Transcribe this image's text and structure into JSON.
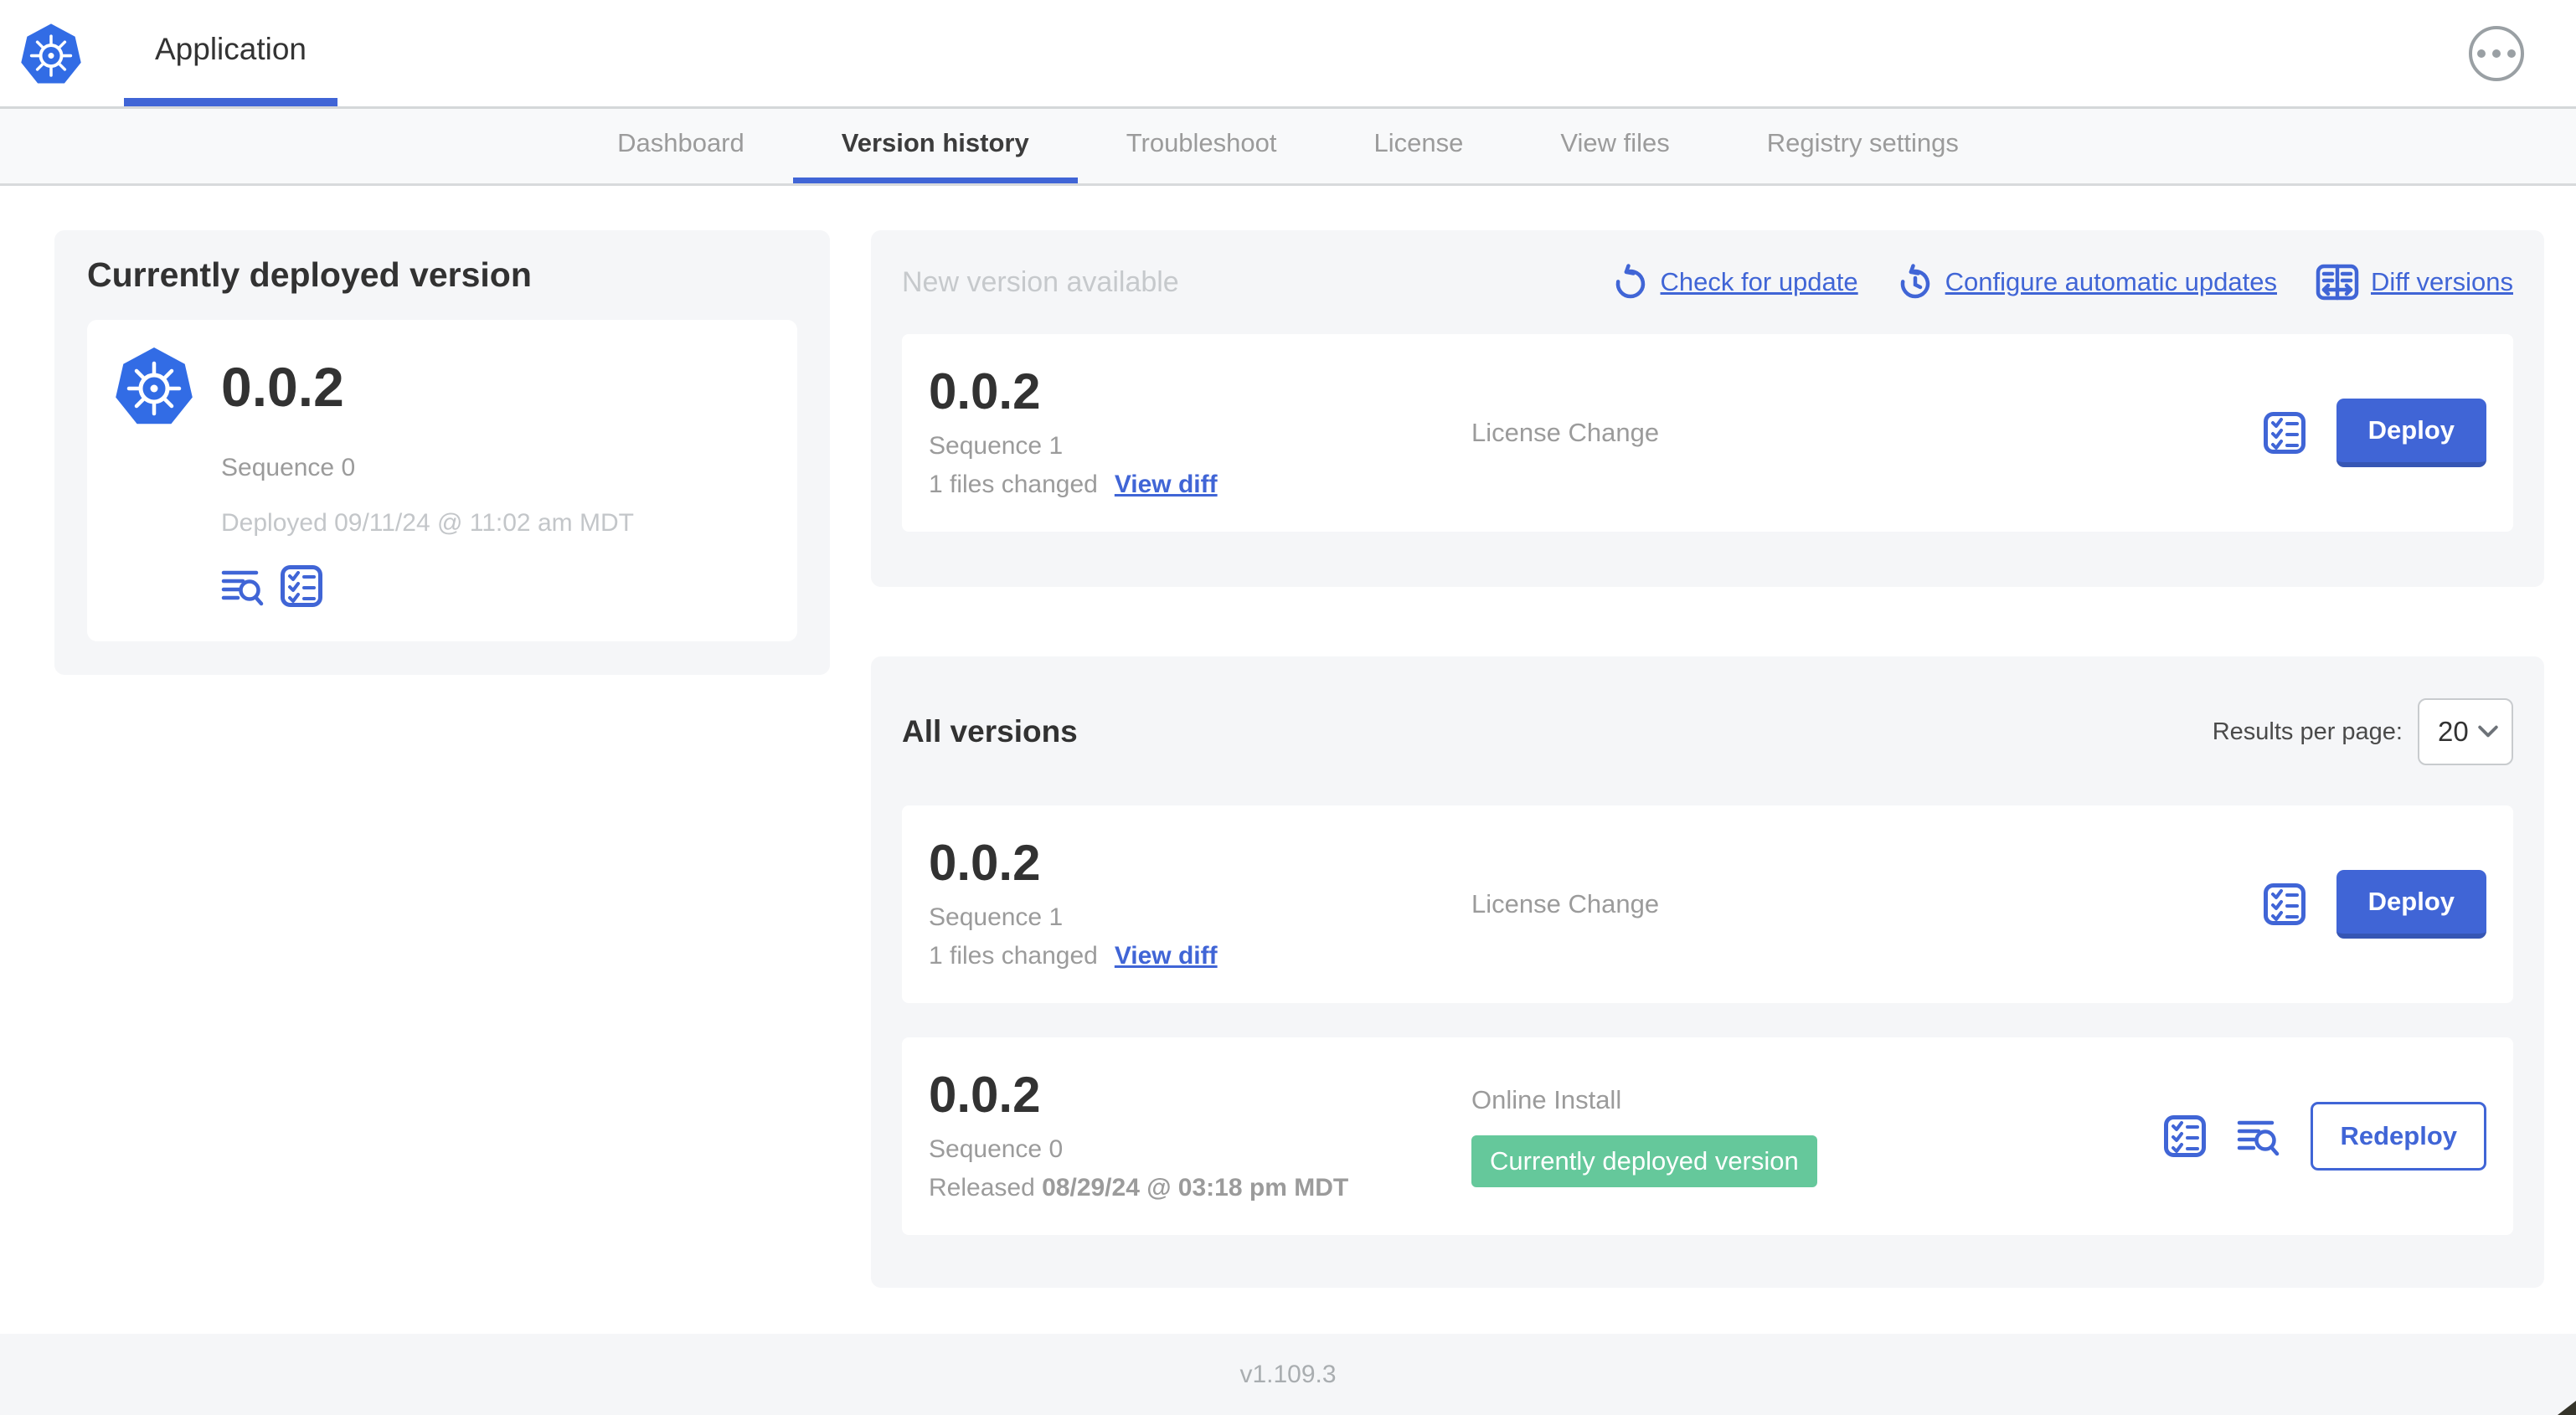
{
  "header": {
    "app_label": "Application"
  },
  "nav": {
    "tabs": [
      "Dashboard",
      "Version history",
      "Troubleshoot",
      "License",
      "View files",
      "Registry settings"
    ],
    "active_tab": "Version history"
  },
  "current_version": {
    "heading": "Currently deployed version",
    "version": "0.0.2",
    "sequence": "Sequence 0",
    "deployed": "Deployed 09/11/24 @ 11:02 am MDT"
  },
  "new_version": {
    "heading": "New version available",
    "check_for_update": "Check for update",
    "configure_updates": "Configure automatic updates",
    "diff_versions": "Diff versions",
    "card": {
      "version": "0.0.2",
      "sequence": "Sequence 1",
      "files_changed": "1 files changed",
      "view_diff": "View diff",
      "source": "License Change",
      "deploy": "Deploy"
    }
  },
  "all_versions": {
    "heading": "All versions",
    "results_per_page_label": "Results per page:",
    "results_per_page": "20",
    "rows": [
      {
        "version": "0.0.2",
        "sequence": "Sequence 1",
        "files_changed": "1 files changed",
        "view_diff": "View diff",
        "source": "License Change",
        "action": "Deploy"
      },
      {
        "version": "0.0.2",
        "sequence": "Sequence 0",
        "released_label": "Released",
        "released_date": "08/29/24 @ 03:18 pm MDT",
        "source": "Online Install",
        "badge": "Currently deployed version",
        "action": "Redeploy"
      }
    ]
  },
  "footer": {
    "app_version": "v1.109.3"
  },
  "colors": {
    "primary_blue": "#4065d6",
    "logo_blue": "#326ce5",
    "badge_green": "#65c89b"
  }
}
